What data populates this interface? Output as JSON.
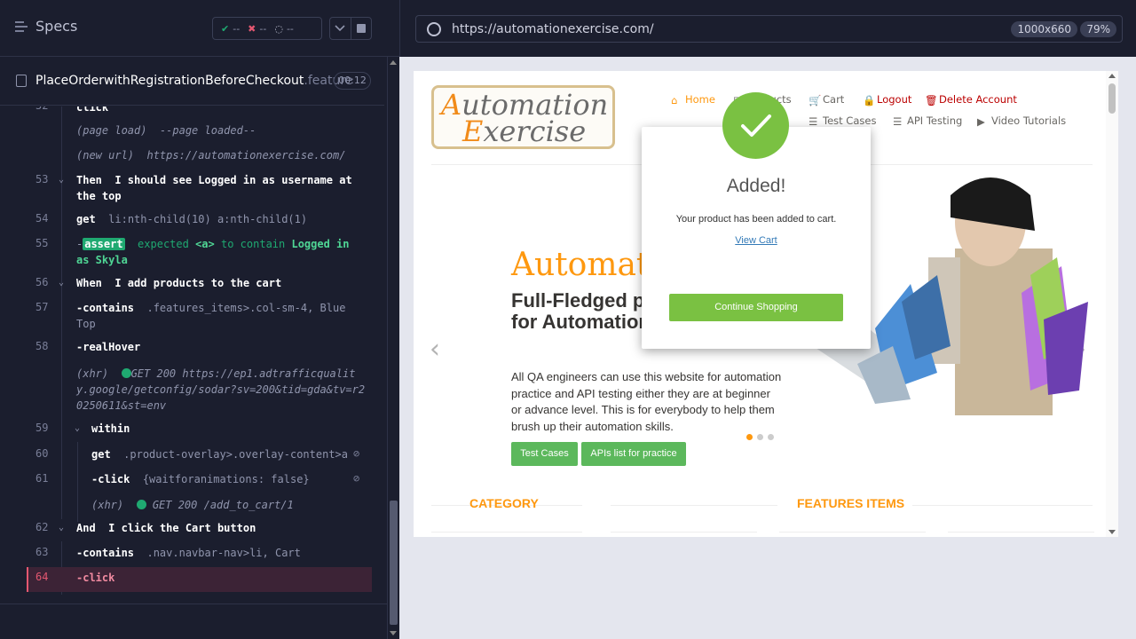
{
  "header": {
    "specs_label": "Specs",
    "passed": "--",
    "failed": "--",
    "pending": "--"
  },
  "file": {
    "name": "PlaceOrderwithRegistrationBeforeCheckout",
    "ext": ".feature",
    "duration": "00:12"
  },
  "log": {
    "r52_ln": "52",
    "r52_cmd": "click",
    "r52b_label": "(page load)",
    "r52b_msg": "--page loaded--",
    "r52c_label": "(new url)",
    "r52c_msg": "https://automationexercise.com/",
    "r53_ln": "53",
    "r53_kw": "Then",
    "r53_text": "I should see Logged in as username at the top",
    "r54_ln": "54",
    "r54_cmd": "get",
    "r54_arg": "li:nth-child(10) a:nth-child(1)",
    "r55_ln": "55",
    "r55_dash": "-",
    "r55_badge": "assert",
    "r55_t1": "expected",
    "r55_t2": "<a>",
    "r55_t3": "to contain",
    "r55_t4": "Logged in as Skyla",
    "r56_ln": "56",
    "r56_kw": "When",
    "r56_text": "I add products to the cart",
    "r57_ln": "57",
    "r57_cmd": "-contains",
    "r57_arg": ".features_items>.col-sm-4, Blue Top",
    "r58_ln": "58",
    "r58_cmd": "-realHover",
    "r58b_label": "(xhr)",
    "r58b_status": "GET 200",
    "r58b_url": "https://ep1.adtrafficquality.google/getconfig/sodar?sv=200&tid=gda&tv=r20250611&st=env",
    "r59_ln": "59",
    "r59_cmd": "within",
    "r60_ln": "60",
    "r60_cmd": "get",
    "r60_arg": ".product-overlay>.overlay-content>a",
    "r61_ln": "61",
    "r61_cmd": "-click",
    "r61_arg": "{waitforanimations: false}",
    "r61b_label": "(xhr)",
    "r61b_status": "GET 200 /add_to_cart/1",
    "r62_ln": "62",
    "r62_kw": "And",
    "r62_text": "I click the Cart button",
    "r63_ln": "63",
    "r63_cmd": "-contains",
    "r63_arg": ".nav.navbar-nav>li, Cart",
    "r64_ln": "64",
    "r64_cmd": "-click"
  },
  "browser": {
    "url": "https://automationexercise.com/",
    "viewport": "1000x660",
    "zoom": "79%"
  },
  "site": {
    "logo_line1_o": "A",
    "logo_line1": "utomation",
    "logo_line2_o": "E",
    "logo_line2": "xercise",
    "nav": {
      "home": "Home",
      "products": "Products",
      "cart": "Cart",
      "logout": "Logout",
      "delete": "Delete Account",
      "testcases": "Test Cases",
      "api": "API Testing",
      "videos": "Video Tutorials"
    },
    "hero_h1": "Automation",
    "hero_h2": "Full-Fledged practice website for Automation Engineers",
    "hero_p": "All QA engineers can use this website for automation practice and API testing either they are at beginner or advance level. This is for everybody to help them brush up their automation skills.",
    "btn_testcases": "Test Cases",
    "btn_apis": "APIs list for practice",
    "category": "CATEGORY",
    "features": "FEATURES ITEMS"
  },
  "modal": {
    "title": "Added!",
    "body": "Your product has been added to cart.",
    "link": "View Cart",
    "button": "Continue Shopping"
  },
  "colors": {
    "accent": "#fe980f",
    "pass": "#1fa971",
    "fail": "#e45770",
    "modal_green": "#7ac142"
  }
}
